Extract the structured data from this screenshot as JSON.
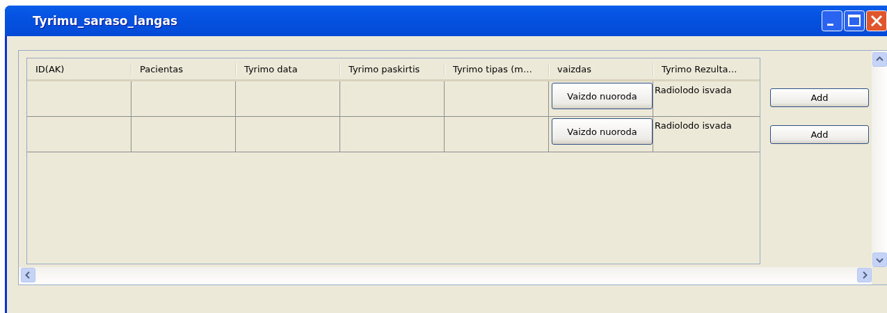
{
  "window": {
    "title": "Tyrimu_saraso_langas"
  },
  "table": {
    "columns": [
      "ID(AK)",
      "Pacientas",
      "Tyrimo data",
      "Tyrimo paskirtis",
      "Tyrimo tipas (m…",
      "vaizdas",
      "Tyrimo Rezulta…"
    ],
    "rows": [
      {
        "image_button": "Vaizdo nuoroda",
        "result": "Radiolodo isvada"
      },
      {
        "image_button": "Vaizdo nuoroda",
        "result": "Radiolodo isvada"
      }
    ]
  },
  "side_buttons": [
    "Add",
    "Add"
  ]
}
